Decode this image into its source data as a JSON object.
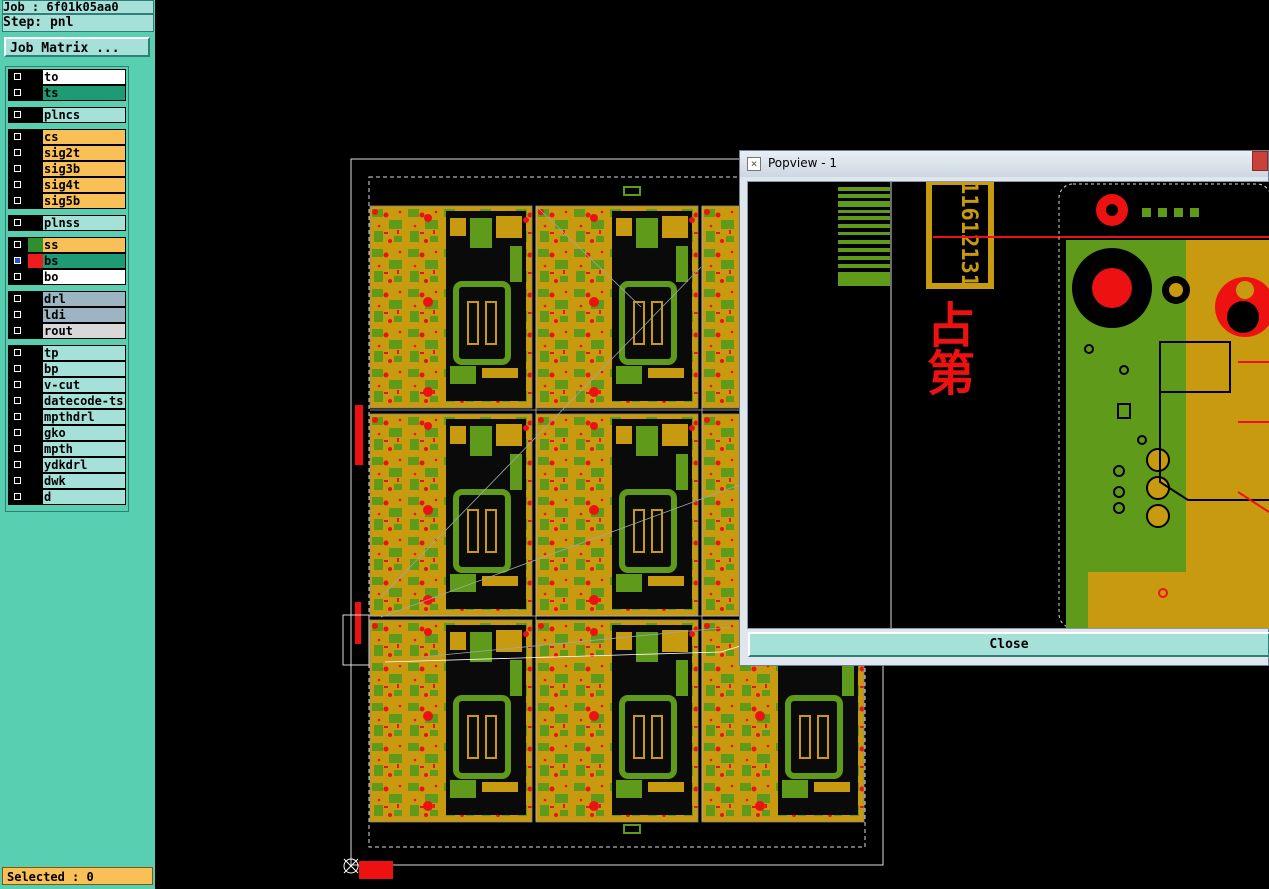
{
  "panel": {
    "job_label": "Job : 6f01k05aa0",
    "step_label": "Step: pnl",
    "job_matrix_button": "Job Matrix ...",
    "selected_label": "Selected : 0"
  },
  "layer_groups": [
    [
      {
        "name": "to",
        "color": "#ffffff",
        "swatch": ""
      },
      {
        "name": "ts",
        "color": "#1e9a74",
        "swatch": ""
      }
    ],
    [
      {
        "name": "plncs",
        "color": "#a6e1d9",
        "swatch": ""
      }
    ],
    [
      {
        "name": "cs",
        "color": "#f8c056",
        "swatch": ""
      },
      {
        "name": "sig2t",
        "color": "#f8c056",
        "swatch": ""
      },
      {
        "name": "sig3b",
        "color": "#f8c056",
        "swatch": ""
      },
      {
        "name": "sig4t",
        "color": "#f8c056",
        "swatch": ""
      },
      {
        "name": "sig5b",
        "color": "#f8c056",
        "swatch": ""
      }
    ],
    [
      {
        "name": "plnss",
        "color": "#a6e1d9",
        "swatch": ""
      }
    ],
    [
      {
        "name": "ss",
        "color": "#f8c056",
        "swatch": "#2f8f2f"
      },
      {
        "name": "bs",
        "color": "#1e9a74",
        "swatch": "#ee1c1c",
        "active": true
      },
      {
        "name": "bo",
        "color": "#ffffff",
        "swatch": ""
      }
    ],
    [
      {
        "name": "drl",
        "color": "#9db5c2",
        "swatch": ""
      },
      {
        "name": "ldi",
        "color": "#9db5c2",
        "swatch": ""
      },
      {
        "name": "rout",
        "color": "#d8d8d8",
        "swatch": ""
      }
    ],
    [
      {
        "name": "tp",
        "color": "#a6e1d9",
        "swatch": ""
      },
      {
        "name": "bp",
        "color": "#a6e1d9",
        "swatch": ""
      },
      {
        "name": "v-cut",
        "color": "#a6e1d9",
        "swatch": ""
      },
      {
        "name": "datecode-ts",
        "color": "#a6e1d9",
        "swatch": ""
      },
      {
        "name": "mpthdrl",
        "color": "#a6e1d9",
        "swatch": ""
      },
      {
        "name": "gko",
        "color": "#a6e1d9",
        "swatch": ""
      },
      {
        "name": "mpth",
        "color": "#a6e1d9",
        "swatch": ""
      },
      {
        "name": "ydkdrl",
        "color": "#a6e1d9",
        "swatch": ""
      },
      {
        "name": "dwk",
        "color": "#a6e1d9",
        "swatch": ""
      },
      {
        "name": "d",
        "color": "#a6e1d9",
        "swatch": ""
      }
    ]
  ],
  "popview": {
    "title": "Popview - 1",
    "close_label": "Close",
    "code_text": "11612131",
    "cjk_text": "占第"
  },
  "colors": {
    "panel_bg": "#57cfb0",
    "board_yellow": "#c89a10",
    "board_green": "#5f9a1a",
    "pad_red": "#ee1111"
  }
}
